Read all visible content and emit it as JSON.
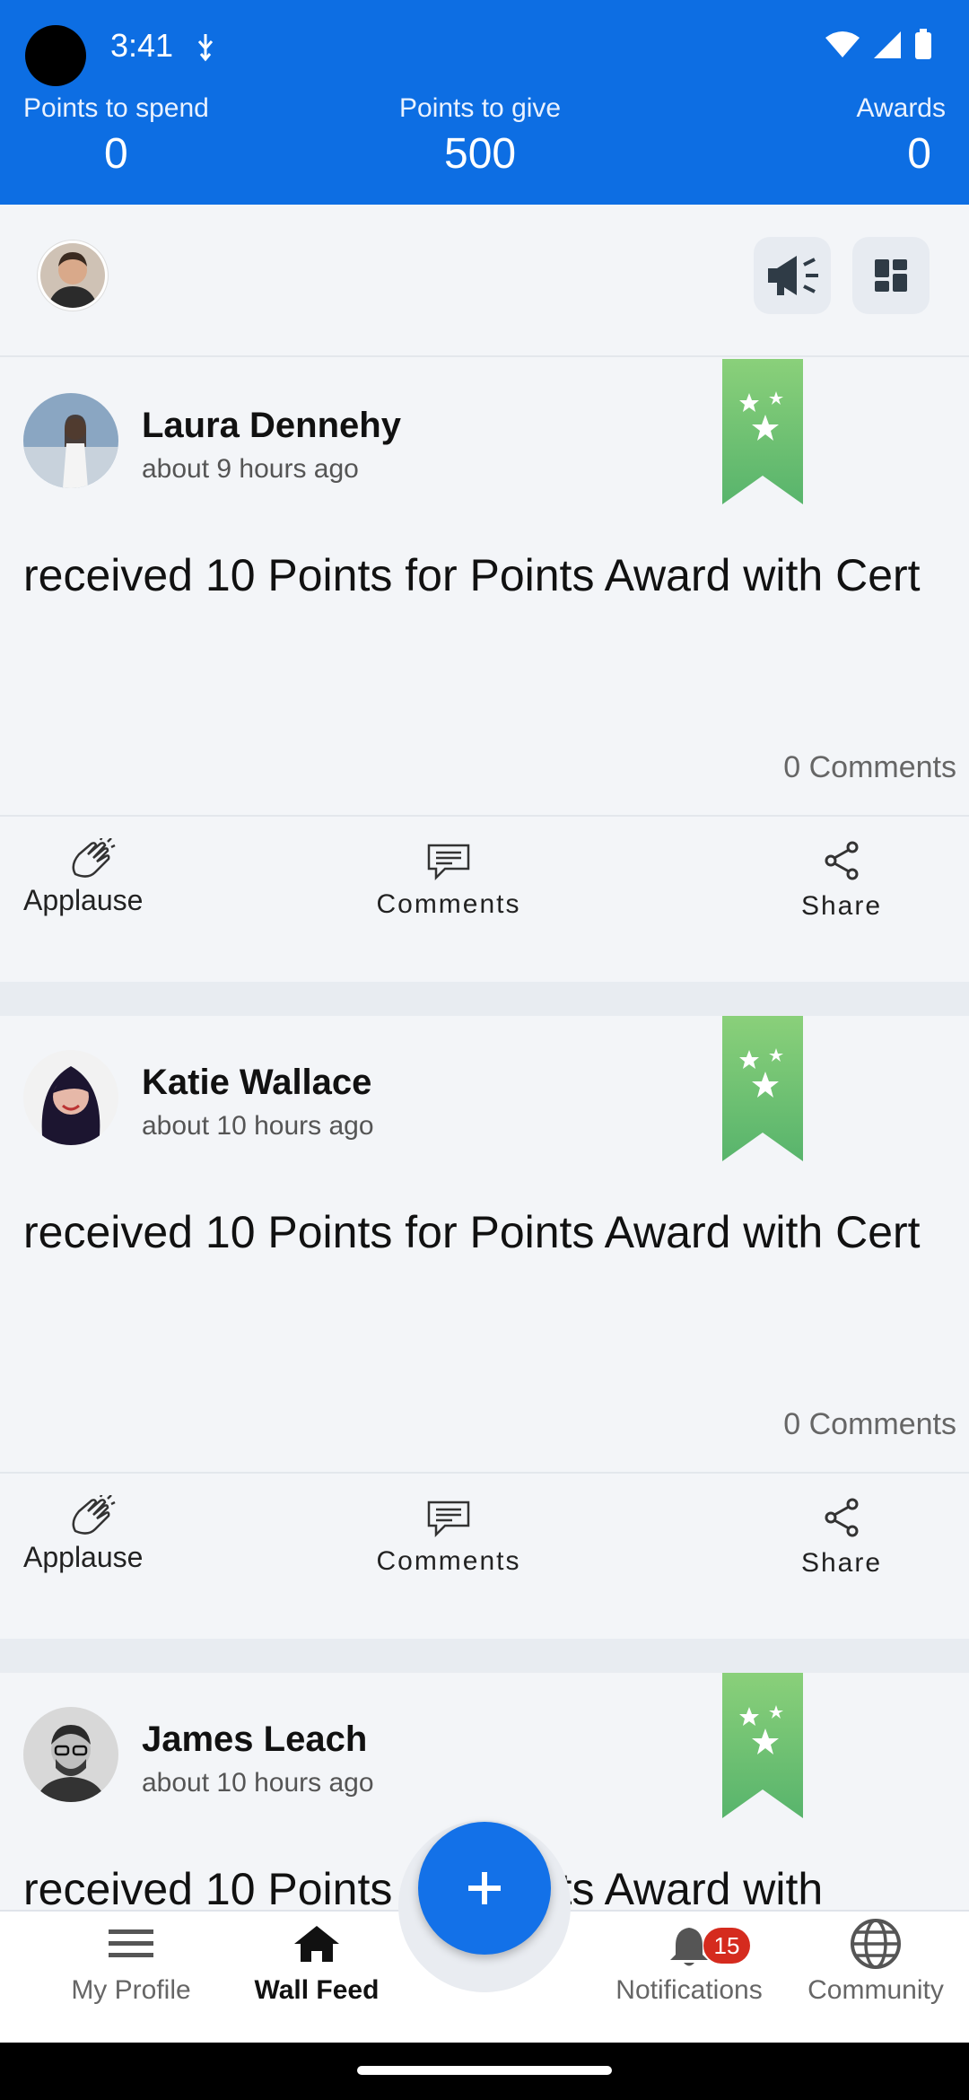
{
  "status": {
    "time": "3:41"
  },
  "header": {
    "points_to_spend": {
      "label": "Points to spend",
      "value": "0"
    },
    "points_to_give": {
      "label": "Points to give",
      "value": "500"
    },
    "awards": {
      "label": "Awards",
      "value": "0"
    }
  },
  "posts": [
    {
      "name": "Laura Dennehy",
      "time": "about 9 hours ago",
      "message": "received 10 Points for Points Award with Cert",
      "comments_count": "0 Comments"
    },
    {
      "name": "Katie Wallace",
      "time": "about 10 hours ago",
      "message": "received 10 Points for Points Award with Cert",
      "comments_count": "0 Comments"
    },
    {
      "name": "James Leach",
      "time": "about 10 hours ago",
      "message": "received 10 Points for Points Award with"
    }
  ],
  "actions": {
    "applause": "Applause",
    "comments": "Comments",
    "share": "Share"
  },
  "nav": {
    "my_profile": "My Profile",
    "wall_feed": "Wall Feed",
    "notifications": "Notifications",
    "notifications_badge": "15",
    "community": "Community"
  },
  "colors": {
    "primary": "#0d6ee3",
    "ribbon": "#6cc070",
    "badge": "#d52b1e"
  },
  "icons": [
    "megaphone-icon",
    "grid-icon",
    "award-ribbon-icon",
    "applause-icon",
    "comments-icon",
    "share-icon",
    "menu-icon",
    "home-icon",
    "bell-icon",
    "globe-icon",
    "plus-icon"
  ]
}
